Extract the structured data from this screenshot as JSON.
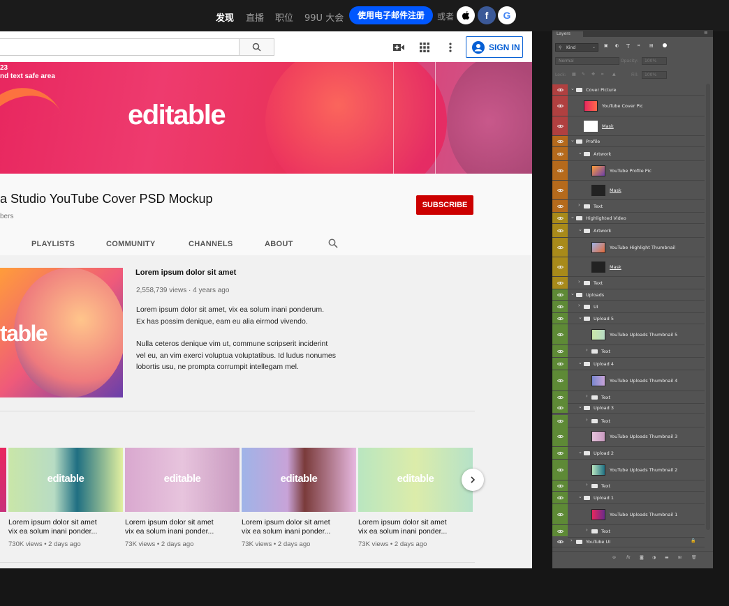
{
  "topnav": {
    "items": [
      {
        "label": "发现",
        "active": true
      },
      {
        "label": "直播",
        "active": false
      },
      {
        "label": "职位",
        "active": false
      },
      {
        "label": "99U 大会",
        "active": false
      }
    ],
    "register_button": "使用电子邮件注册",
    "or_label": "或者",
    "accent": "#0057ff"
  },
  "youtube": {
    "sign_in": "SIGN IN",
    "banner": {
      "line1": "23",
      "line2": "nd text safe area",
      "title": "editable"
    },
    "channel": {
      "name": "a Studio YouTube Cover PSD Mockup",
      "subs": "bers",
      "subscribe": "SUBSCRIBE"
    },
    "tabs": [
      "PLAYLISTS",
      "COMMUNITY",
      "CHANNELS",
      "ABOUT"
    ],
    "featured": {
      "thumb_text": "table",
      "title": "Lorem ipsum dolor sit amet",
      "meta": "2,558,739 views · 4 years ago",
      "desc1_line1": "Lorem ipsum dolor sit amet, vix ea solum inani ponderum.",
      "desc1_line2": "Ex has possim denique, eam eu alia eirmod vivendo.",
      "desc2_line1": "Nulla ceteros denique vim ut, commune scripserit inciderint",
      "desc2_line2": "vel eu, an vim exerci voluptua voluptatibus. Id ludus nonumes",
      "desc2_line3": "lobortis usu, ne prompta corrumpit intellegam mel."
    },
    "videos": [
      {
        "thumb_text": "editable",
        "title_line1": "Lorem ipsum dolor sit amet",
        "title_line2": "vix ea solum inani ponder...",
        "meta": "730K views • 2 days ago"
      },
      {
        "thumb_text": "editable",
        "title_line1": "Lorem ipsum dolor sit amet",
        "title_line2": "vix ea solum inani ponder...",
        "meta": "73K views • 2 days ago"
      },
      {
        "thumb_text": "editable",
        "title_line1": "Lorem ipsum dolor sit amet",
        "title_line2": "vix ea solum inani ponder...",
        "meta": "73K views • 2 days ago"
      },
      {
        "thumb_text": "editable",
        "title_line1": "Lorem ipsum dolor sit amet",
        "title_line2": "vix ea solum inani ponder...",
        "meta": "73K views • 2 days ago"
      }
    ],
    "subscribe_color": "#cc0000",
    "link_color": "#065fd4"
  },
  "layers_panel": {
    "tab": "Layers",
    "filter": "Kind",
    "blend_mode": "Normal",
    "opacity_label": "Opacity:",
    "opacity_value": "100%",
    "lock_label": "Lock:",
    "fill_label": "Fill:",
    "fill_value": "100%",
    "group_colors": {
      "red": "#b04040",
      "orange": "#b56a1c",
      "yellow": "#a88a1a",
      "green": "#5e8a36"
    },
    "layers": [
      {
        "label": "Cover Picture",
        "kind": "group",
        "color": "red"
      },
      {
        "label": "YouTube Cover Pic",
        "kind": "smart",
        "color": "red"
      },
      {
        "label": "Mask",
        "kind": "mask",
        "color": "red"
      },
      {
        "label": "Profile",
        "kind": "group",
        "color": "orange"
      },
      {
        "label": "Artwork",
        "kind": "group",
        "color": "orange"
      },
      {
        "label": "YouTube Profile Pic",
        "kind": "smart",
        "color": "orange"
      },
      {
        "label": "Mask",
        "kind": "mask",
        "color": "orange"
      },
      {
        "label": "Text",
        "kind": "group",
        "color": "orange"
      },
      {
        "label": "Highlighted Video",
        "kind": "group",
        "color": "yellow"
      },
      {
        "label": "Artwork",
        "kind": "group",
        "color": "yellow"
      },
      {
        "label": "YouTube Highlight Thumbnail",
        "kind": "smart",
        "color": "yellow"
      },
      {
        "label": "Mask",
        "kind": "mask",
        "color": "yellow"
      },
      {
        "label": "Text",
        "kind": "group",
        "color": "yellow"
      },
      {
        "label": "Uploads",
        "kind": "group",
        "color": "green"
      },
      {
        "label": "UI",
        "kind": "group",
        "color": "green"
      },
      {
        "label": "Upload 5",
        "kind": "group",
        "color": "green"
      },
      {
        "label": "YouTube Uploads Thumbnail 5",
        "kind": "smart",
        "color": "green"
      },
      {
        "label": "Text",
        "kind": "group",
        "color": "green"
      },
      {
        "label": "Upload 4",
        "kind": "group",
        "color": "green"
      },
      {
        "label": "YouTube Uploads Thumbnail 4",
        "kind": "smart",
        "color": "green"
      },
      {
        "label": "Text",
        "kind": "group",
        "color": "green"
      },
      {
        "label": "Upload 3",
        "kind": "group",
        "color": "green"
      },
      {
        "label": "Text",
        "kind": "group",
        "color": "green"
      },
      {
        "label": "YouTube Uploads Thumbnail 3",
        "kind": "smart",
        "color": "green"
      },
      {
        "label": "Upload 2",
        "kind": "group",
        "color": "green"
      },
      {
        "label": "YouTube Uploads Thumbnail 2",
        "kind": "smart",
        "color": "green"
      },
      {
        "label": "Text",
        "kind": "group",
        "color": "green"
      },
      {
        "label": "Upload 1",
        "kind": "group",
        "color": "green"
      },
      {
        "label": "YouTube Uploads Thumbnail 1",
        "kind": "smart",
        "color": "green"
      },
      {
        "label": "Text",
        "kind": "group",
        "color": "green"
      },
      {
        "label": "YouTube UI",
        "kind": "group",
        "color": "none"
      }
    ]
  }
}
